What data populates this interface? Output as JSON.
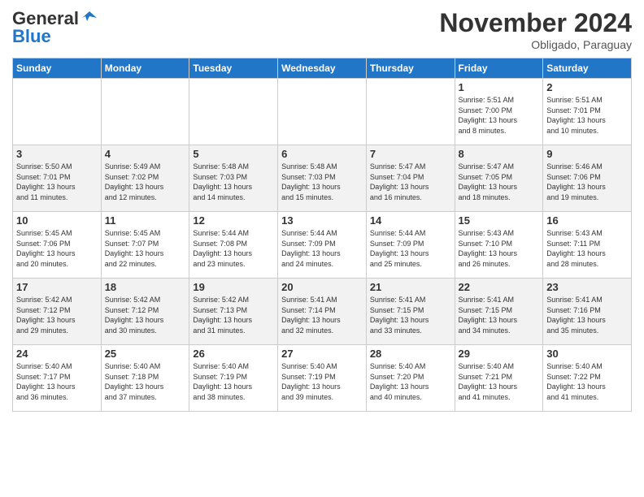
{
  "header": {
    "logo_general": "General",
    "logo_blue": "Blue",
    "title": "November 2024",
    "location": "Obligado, Paraguay"
  },
  "days_of_week": [
    "Sunday",
    "Monday",
    "Tuesday",
    "Wednesday",
    "Thursday",
    "Friday",
    "Saturday"
  ],
  "weeks": [
    [
      {
        "day": "",
        "detail": ""
      },
      {
        "day": "",
        "detail": ""
      },
      {
        "day": "",
        "detail": ""
      },
      {
        "day": "",
        "detail": ""
      },
      {
        "day": "",
        "detail": ""
      },
      {
        "day": "1",
        "detail": "Sunrise: 5:51 AM\nSunset: 7:00 PM\nDaylight: 13 hours\nand 8 minutes."
      },
      {
        "day": "2",
        "detail": "Sunrise: 5:51 AM\nSunset: 7:01 PM\nDaylight: 13 hours\nand 10 minutes."
      }
    ],
    [
      {
        "day": "3",
        "detail": "Sunrise: 5:50 AM\nSunset: 7:01 PM\nDaylight: 13 hours\nand 11 minutes."
      },
      {
        "day": "4",
        "detail": "Sunrise: 5:49 AM\nSunset: 7:02 PM\nDaylight: 13 hours\nand 12 minutes."
      },
      {
        "day": "5",
        "detail": "Sunrise: 5:48 AM\nSunset: 7:03 PM\nDaylight: 13 hours\nand 14 minutes."
      },
      {
        "day": "6",
        "detail": "Sunrise: 5:48 AM\nSunset: 7:03 PM\nDaylight: 13 hours\nand 15 minutes."
      },
      {
        "day": "7",
        "detail": "Sunrise: 5:47 AM\nSunset: 7:04 PM\nDaylight: 13 hours\nand 16 minutes."
      },
      {
        "day": "8",
        "detail": "Sunrise: 5:47 AM\nSunset: 7:05 PM\nDaylight: 13 hours\nand 18 minutes."
      },
      {
        "day": "9",
        "detail": "Sunrise: 5:46 AM\nSunset: 7:06 PM\nDaylight: 13 hours\nand 19 minutes."
      }
    ],
    [
      {
        "day": "10",
        "detail": "Sunrise: 5:45 AM\nSunset: 7:06 PM\nDaylight: 13 hours\nand 20 minutes."
      },
      {
        "day": "11",
        "detail": "Sunrise: 5:45 AM\nSunset: 7:07 PM\nDaylight: 13 hours\nand 22 minutes."
      },
      {
        "day": "12",
        "detail": "Sunrise: 5:44 AM\nSunset: 7:08 PM\nDaylight: 13 hours\nand 23 minutes."
      },
      {
        "day": "13",
        "detail": "Sunrise: 5:44 AM\nSunset: 7:09 PM\nDaylight: 13 hours\nand 24 minutes."
      },
      {
        "day": "14",
        "detail": "Sunrise: 5:44 AM\nSunset: 7:09 PM\nDaylight: 13 hours\nand 25 minutes."
      },
      {
        "day": "15",
        "detail": "Sunrise: 5:43 AM\nSunset: 7:10 PM\nDaylight: 13 hours\nand 26 minutes."
      },
      {
        "day": "16",
        "detail": "Sunrise: 5:43 AM\nSunset: 7:11 PM\nDaylight: 13 hours\nand 28 minutes."
      }
    ],
    [
      {
        "day": "17",
        "detail": "Sunrise: 5:42 AM\nSunset: 7:12 PM\nDaylight: 13 hours\nand 29 minutes."
      },
      {
        "day": "18",
        "detail": "Sunrise: 5:42 AM\nSunset: 7:12 PM\nDaylight: 13 hours\nand 30 minutes."
      },
      {
        "day": "19",
        "detail": "Sunrise: 5:42 AM\nSunset: 7:13 PM\nDaylight: 13 hours\nand 31 minutes."
      },
      {
        "day": "20",
        "detail": "Sunrise: 5:41 AM\nSunset: 7:14 PM\nDaylight: 13 hours\nand 32 minutes."
      },
      {
        "day": "21",
        "detail": "Sunrise: 5:41 AM\nSunset: 7:15 PM\nDaylight: 13 hours\nand 33 minutes."
      },
      {
        "day": "22",
        "detail": "Sunrise: 5:41 AM\nSunset: 7:15 PM\nDaylight: 13 hours\nand 34 minutes."
      },
      {
        "day": "23",
        "detail": "Sunrise: 5:41 AM\nSunset: 7:16 PM\nDaylight: 13 hours\nand 35 minutes."
      }
    ],
    [
      {
        "day": "24",
        "detail": "Sunrise: 5:40 AM\nSunset: 7:17 PM\nDaylight: 13 hours\nand 36 minutes."
      },
      {
        "day": "25",
        "detail": "Sunrise: 5:40 AM\nSunset: 7:18 PM\nDaylight: 13 hours\nand 37 minutes."
      },
      {
        "day": "26",
        "detail": "Sunrise: 5:40 AM\nSunset: 7:19 PM\nDaylight: 13 hours\nand 38 minutes."
      },
      {
        "day": "27",
        "detail": "Sunrise: 5:40 AM\nSunset: 7:19 PM\nDaylight: 13 hours\nand 39 minutes."
      },
      {
        "day": "28",
        "detail": "Sunrise: 5:40 AM\nSunset: 7:20 PM\nDaylight: 13 hours\nand 40 minutes."
      },
      {
        "day": "29",
        "detail": "Sunrise: 5:40 AM\nSunset: 7:21 PM\nDaylight: 13 hours\nand 41 minutes."
      },
      {
        "day": "30",
        "detail": "Sunrise: 5:40 AM\nSunset: 7:22 PM\nDaylight: 13 hours\nand 41 minutes."
      }
    ]
  ]
}
